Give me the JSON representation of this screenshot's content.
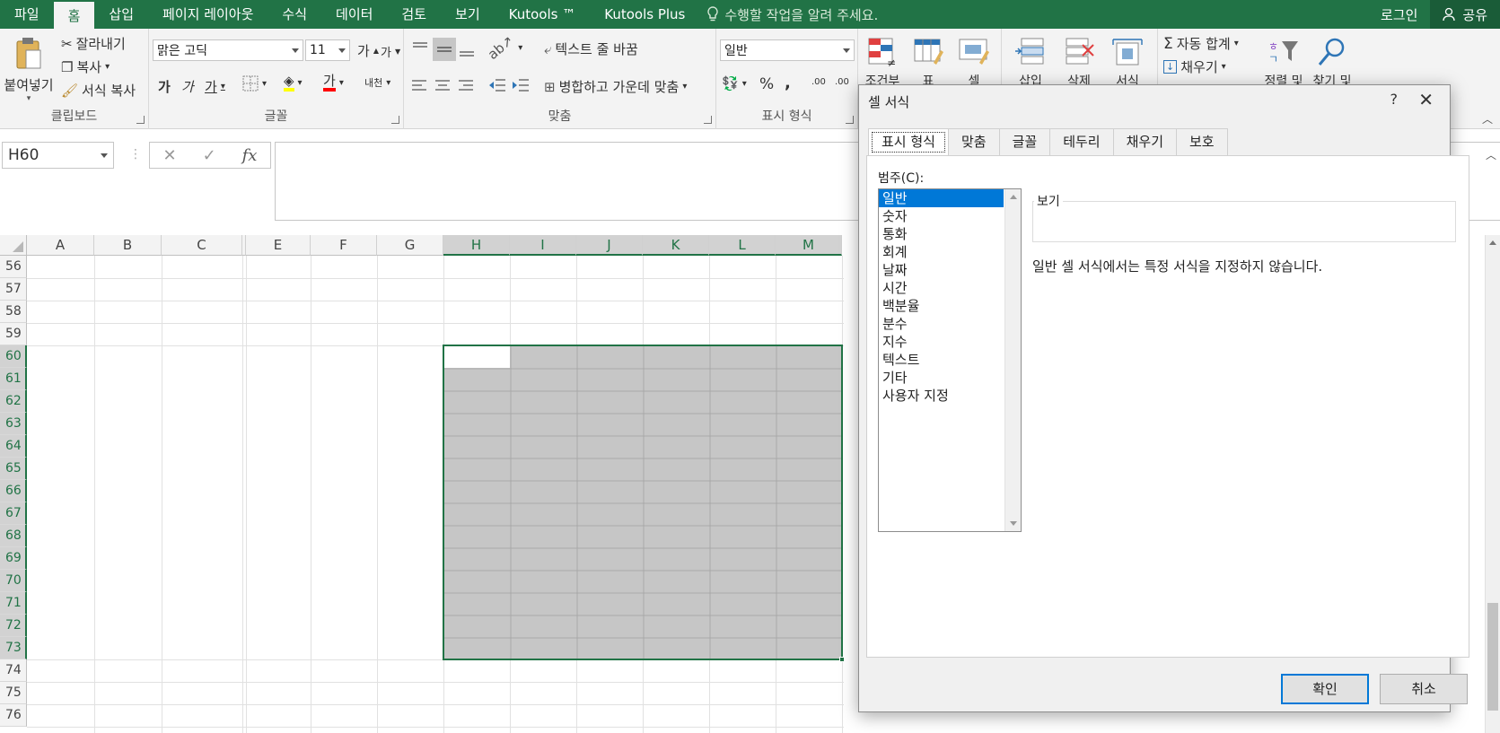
{
  "menu": {
    "tabs": [
      "파일",
      "홈",
      "삽입",
      "페이지 레이아웃",
      "수식",
      "데이터",
      "검토",
      "보기",
      "Kutools ™",
      "Kutools Plus"
    ],
    "active_index": 1,
    "tell_me": "수행할 작업을 알려 주세요.",
    "login": "로그인",
    "share": "공유"
  },
  "ribbon": {
    "clipboard": {
      "paste": "붙여넣기",
      "cut": "잘라내기",
      "copy": "복사",
      "format_painter": "서식 복사",
      "label": "클립보드"
    },
    "font": {
      "name": "맑은 고딕",
      "size": "11",
      "grow": "가",
      "shrink": "가",
      "bold": "가",
      "italic": "가",
      "underline": "가",
      "font_color": "가",
      "phonetic": "내천",
      "label": "글꼴"
    },
    "alignment": {
      "wrap": "텍스트 줄 바꿈",
      "merge": "병합하고 가운데 맞춤",
      "label": "맞춤"
    },
    "number": {
      "format": "일반",
      "percent": "%",
      "comma": ",",
      "inc_decimal": ".00",
      "dec_decimal": ".00",
      "label": "표시 형식"
    },
    "styles": {
      "conditional": "조건부",
      "table": "표",
      "cell": "셀"
    },
    "cells": {
      "insert": "삽입",
      "delete": "삭제",
      "format": "서식"
    },
    "editing": {
      "autosum": "자동 합계",
      "fill": "채우기",
      "sort": "정렬 및",
      "find": "찾기 및"
    }
  },
  "formula": {
    "name_box": "H60",
    "fx": "fx"
  },
  "grid": {
    "columns": [
      "A",
      "B",
      "C",
      "D",
      "E",
      "F",
      "G",
      "H",
      "I",
      "J",
      "K",
      "L",
      "M"
    ],
    "rows": [
      "56",
      "57",
      "58",
      "59",
      "60",
      "61",
      "62",
      "63",
      "64",
      "65",
      "66",
      "67",
      "68",
      "69",
      "70",
      "71",
      "72",
      "73",
      "74",
      "75",
      "76"
    ]
  },
  "dialog": {
    "title": "셀 서식",
    "help": "?",
    "tabs": [
      "표시 형식",
      "맞춤",
      "글꼴",
      "테두리",
      "채우기",
      "보호"
    ],
    "category_label": "범주(C):",
    "categories": [
      "일반",
      "숫자",
      "통화",
      "회계",
      "날짜",
      "시간",
      "백분율",
      "분수",
      "지수",
      "텍스트",
      "기타",
      "사용자 지정"
    ],
    "selected_category": "일반",
    "preview_label": "보기",
    "description": "일반 셀 서식에서는 특정 서식을 지정하지 않습니다.",
    "ok": "확인",
    "cancel": "취소"
  }
}
